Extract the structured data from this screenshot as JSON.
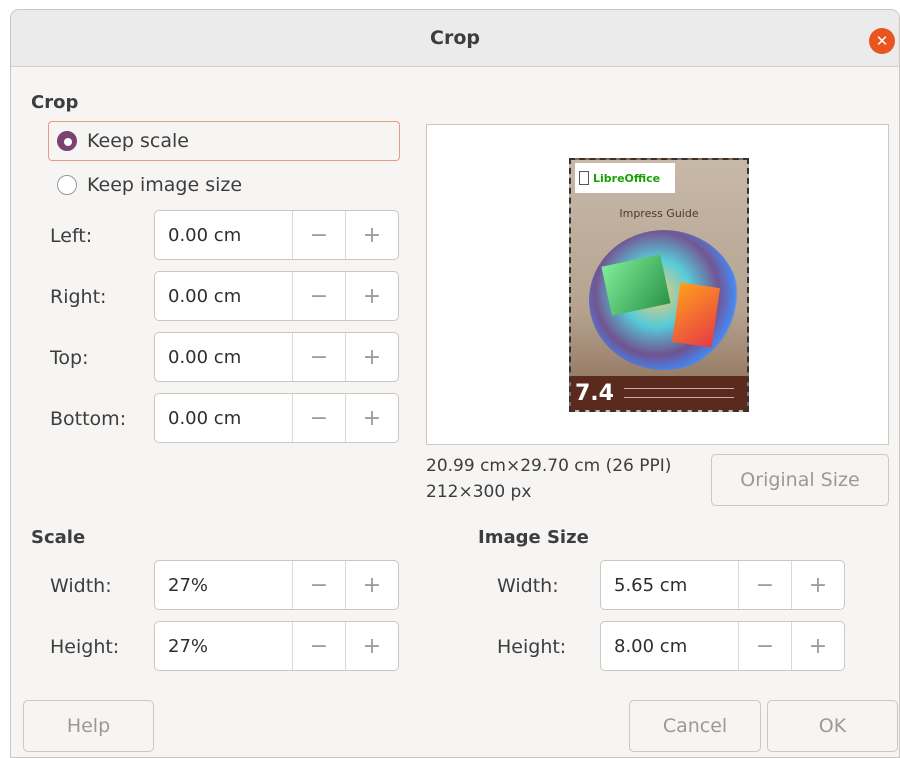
{
  "window": {
    "title": "Crop"
  },
  "crop": {
    "section_title": "Crop",
    "keep_scale": "Keep scale",
    "keep_image_size": "Keep image size",
    "selected": "keep_scale",
    "fields": {
      "left": {
        "label": "Left:",
        "value": "0.00 cm"
      },
      "right": {
        "label": "Right:",
        "value": "0.00 cm"
      },
      "top": {
        "label": "Top:",
        "value": "0.00 cm"
      },
      "bottom": {
        "label": "Bottom:",
        "value": "0.00 cm"
      }
    }
  },
  "preview": {
    "cover_logo": "LibreOffice",
    "cover_title": "Impress Guide",
    "cover_version": "7.4",
    "dimensions": "20.99 cm×29.70 cm (26 PPI)",
    "pixels": "212×300 px",
    "original_size_label": "Original Size"
  },
  "scale": {
    "section_title": "Scale",
    "width": {
      "label": "Width:",
      "value": "27%"
    },
    "height": {
      "label": "Height:",
      "value": "27%"
    }
  },
  "image_size": {
    "section_title": "Image Size",
    "width": {
      "label": "Width:",
      "value": "5.65 cm"
    },
    "height": {
      "label": "Height:",
      "value": "8.00 cm"
    }
  },
  "spin_symbols": {
    "minus": "−",
    "plus": "+"
  },
  "buttons": {
    "help": "Help",
    "cancel": "Cancel",
    "ok": "OK"
  },
  "colors": {
    "accent_radio": "#7a4372",
    "close_button": "#e95420",
    "focus_border": "#e89b80"
  }
}
